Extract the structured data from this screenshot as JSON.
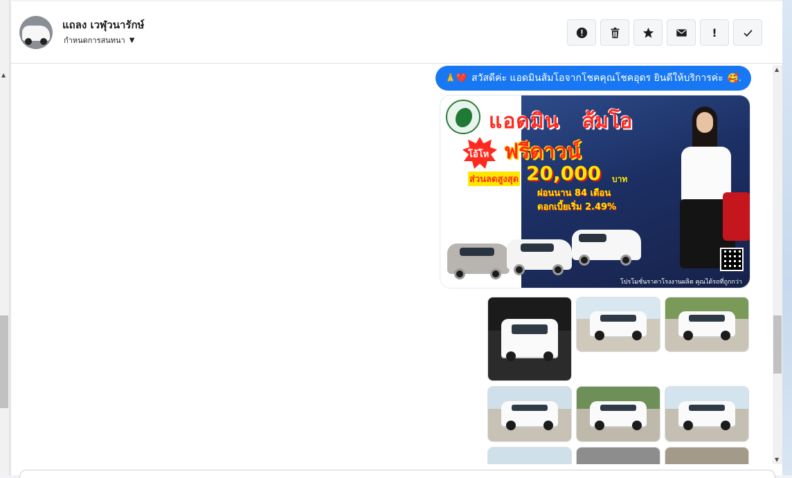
{
  "conversation": {
    "contact_name": "แถลง เวฬุวนารักษ์",
    "assign_label": "กำหนดการสนทนา"
  },
  "toolbar": {
    "buttons": [
      "spam-icon",
      "trash-icon",
      "star-icon",
      "envelope-icon",
      "exclamation-icon",
      "check-icon"
    ],
    "important_glyph": "!"
  },
  "message": {
    "emoji_prefix": "🙏❤️",
    "text": "สวัสดีค่ะ แอดมินส้มโอจากโชคคุณโชคอุดร ยินดีให้บริการค่ะ",
    "emoji_suffix": "🥰."
  },
  "promo": {
    "title_part1": "แอดมิน",
    "title_part2": "ส้มโอ",
    "badge": "โอ้โห",
    "headline": "ฟรีดาวน์",
    "discount_label": "ส่วนลดสูงสุด",
    "discount_amount": "20,000",
    "discount_unit": "บาท",
    "installment": "ผ่อนนาน 84 เดือน",
    "interest": "ดอกเบี้ยเริ่ม 2.49%",
    "footer": "โปรโมชั่นราคาโรงงานผลิต คุณได้รถที่ถูกกว่า"
  },
  "colors": {
    "bubble": "#1877f2",
    "promo_red": "#ff2a1f",
    "promo_yellow": "#ffe600"
  }
}
